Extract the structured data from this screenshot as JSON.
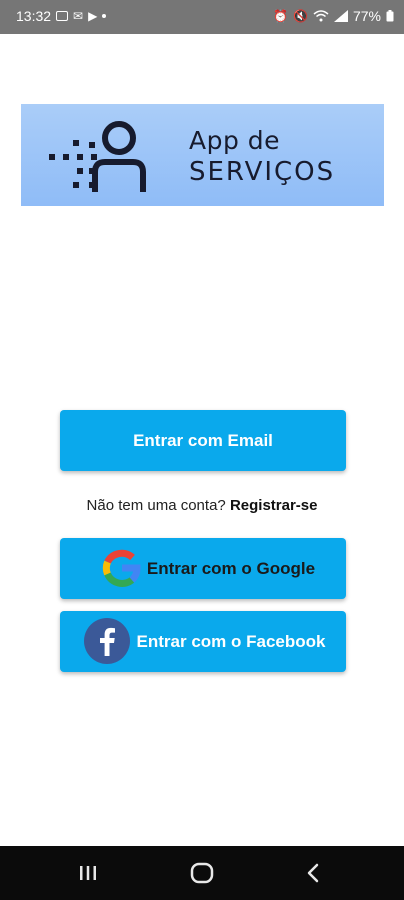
{
  "status_bar": {
    "time": "13:32",
    "left_icons": [
      "gallery-icon",
      "gmail-icon",
      "youtube-icon",
      "dot-icon"
    ],
    "right_icons": [
      "alarm-icon",
      "mute-icon",
      "wifi-icon",
      "signal-icon"
    ],
    "battery": "77%"
  },
  "logo": {
    "line1": "App de",
    "line2": "SERVIÇOS",
    "colors": {
      "background": "#9fc6f8",
      "ink": "#171b2e"
    }
  },
  "buttons": {
    "email_label": "Entrar com Email",
    "google_label": "Entrar com o Google",
    "facebook_label": "Entrar com o Facebook"
  },
  "register": {
    "prompt": "Não tem uma conta?",
    "link": "Registrar-se"
  },
  "colors": {
    "primary": "#0aa9ec",
    "facebook": "#3b5998"
  },
  "nav": {
    "icons": [
      "recent-apps-icon",
      "home-icon",
      "back-icon"
    ]
  }
}
